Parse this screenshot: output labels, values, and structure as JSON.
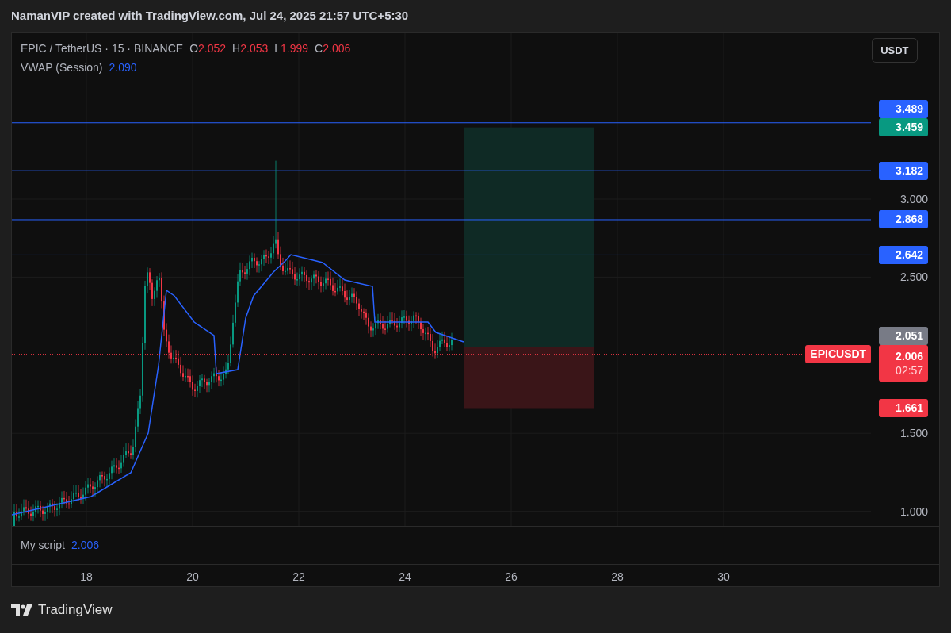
{
  "header": {
    "title": "NamanVIP created with TradingView.com, Jul 24, 2025 21:57 UTC+5:30"
  },
  "legend": {
    "symbol": "EPIC / TetherUS · 15 · BINANCE",
    "ohlc": [
      {
        "key": "O",
        "value": "2.052"
      },
      {
        "key": "H",
        "value": "2.053"
      },
      {
        "key": "L",
        "value": "1.999"
      },
      {
        "key": "C",
        "value": "2.006"
      }
    ],
    "indicator": {
      "name": "VWAP (Session)",
      "value": "2.090"
    }
  },
  "currency_button": "USDT",
  "price_axis": {
    "ticks": [
      "3.000",
      "2.500",
      "1.500",
      "1.000"
    ]
  },
  "levels": [
    {
      "label": "3.489",
      "kind": "line"
    },
    {
      "label": "3.459",
      "kind": "target"
    },
    {
      "label": "3.182",
      "kind": "line"
    },
    {
      "label": "2.868",
      "kind": "line"
    },
    {
      "label": "2.642",
      "kind": "line"
    },
    {
      "label": "2.051",
      "kind": "entry"
    },
    {
      "label": "1.661",
      "kind": "stop"
    }
  ],
  "last_price": {
    "symbol": "EPICUSDT",
    "price": "2.006",
    "countdown": "02:57"
  },
  "script_pane": {
    "name": "My script",
    "value": "2.006"
  },
  "time_axis": {
    "labels": [
      "18",
      "20",
      "22",
      "24",
      "26",
      "28",
      "30"
    ]
  },
  "footer": {
    "brand": "TradingView"
  }
}
